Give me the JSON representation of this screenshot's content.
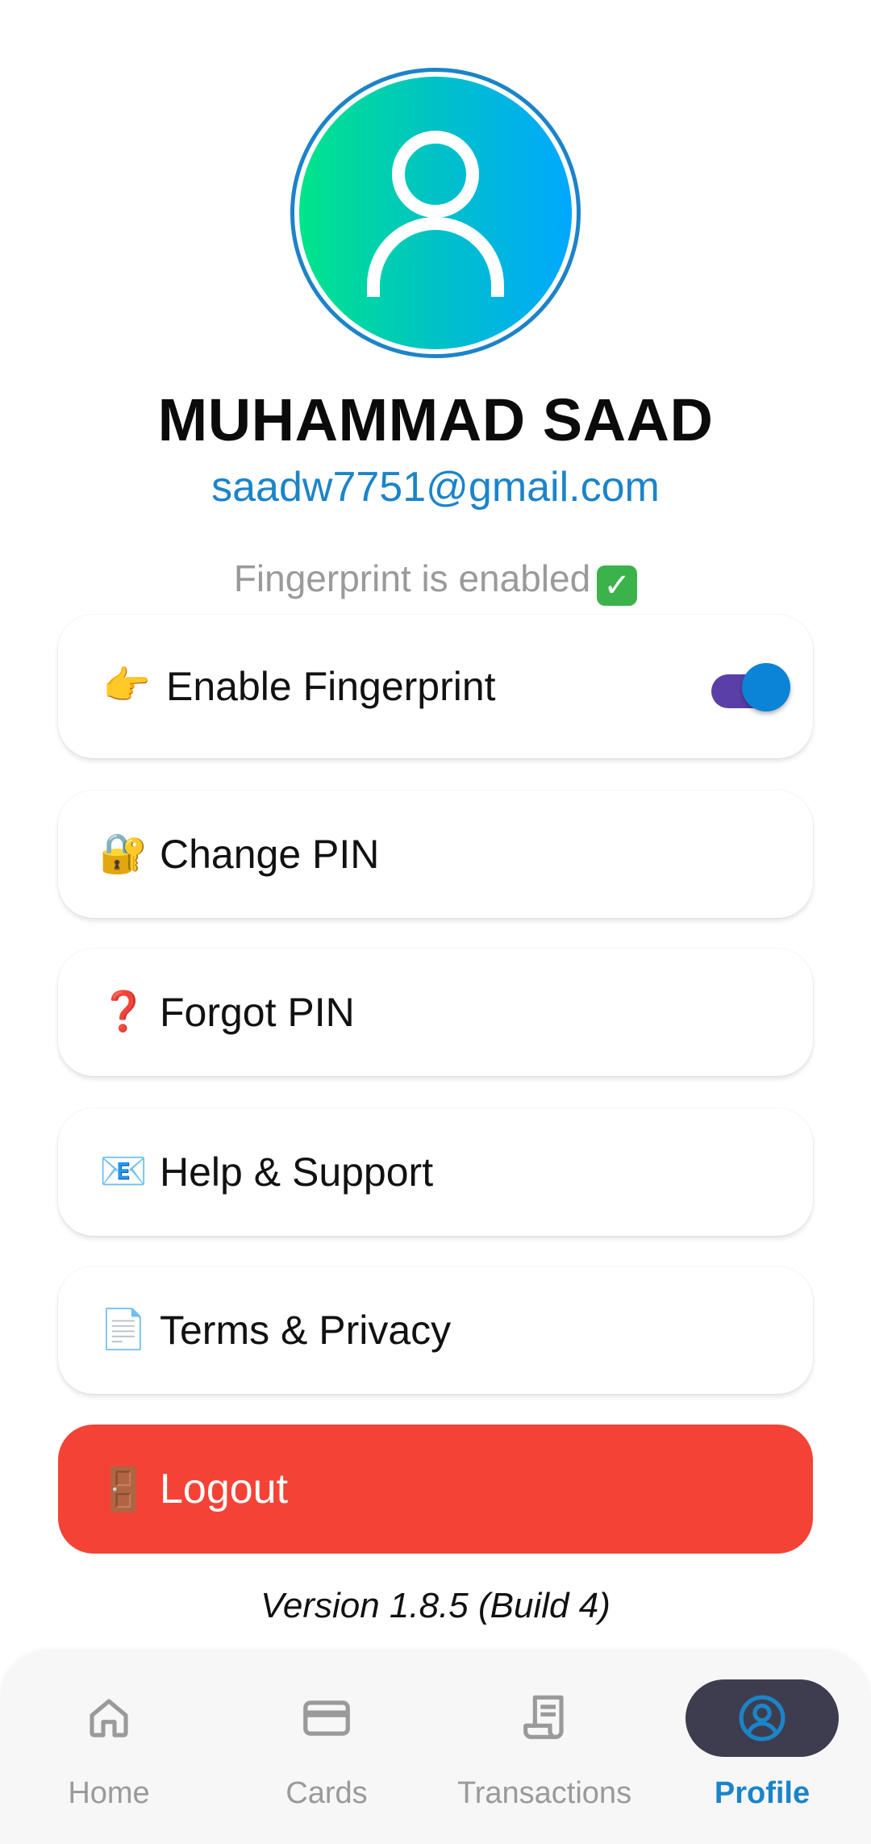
{
  "profile": {
    "name": "MUHAMMAD SAAD",
    "email": "saadw7751@gmail.com",
    "fingerprint_status": "Fingerprint is enabled",
    "avatar_icon": "person-icon"
  },
  "menu": {
    "fingerprint": {
      "emoji": "👉",
      "label": "Enable Fingerprint",
      "toggle_on": true
    },
    "change_pin": {
      "emoji": "🔐",
      "label": "Change PIN"
    },
    "forgot_pin": {
      "emoji": "❓",
      "label": "Forgot PIN"
    },
    "help": {
      "emoji": "📧",
      "label": "Help & Support"
    },
    "terms": {
      "emoji": "📄",
      "label": "Terms & Privacy"
    }
  },
  "logout": {
    "emoji": "🚪",
    "label": "Logout"
  },
  "version": "Version 1.8.5 (Build 4)",
  "nav": {
    "items": [
      {
        "label": "Home",
        "icon": "home-icon",
        "active": false
      },
      {
        "label": "Cards",
        "icon": "card-icon",
        "active": false
      },
      {
        "label": "Transactions",
        "icon": "receipt-icon",
        "active": false
      },
      {
        "label": "Profile",
        "icon": "profile-icon",
        "active": true
      }
    ]
  },
  "colors": {
    "accent": "#1b84c9",
    "logout": "#f44336",
    "toggle_track": "#5b3fa8",
    "toggle_knob": "#0a84d6",
    "nav_active_bg": "#3e3d4f"
  }
}
